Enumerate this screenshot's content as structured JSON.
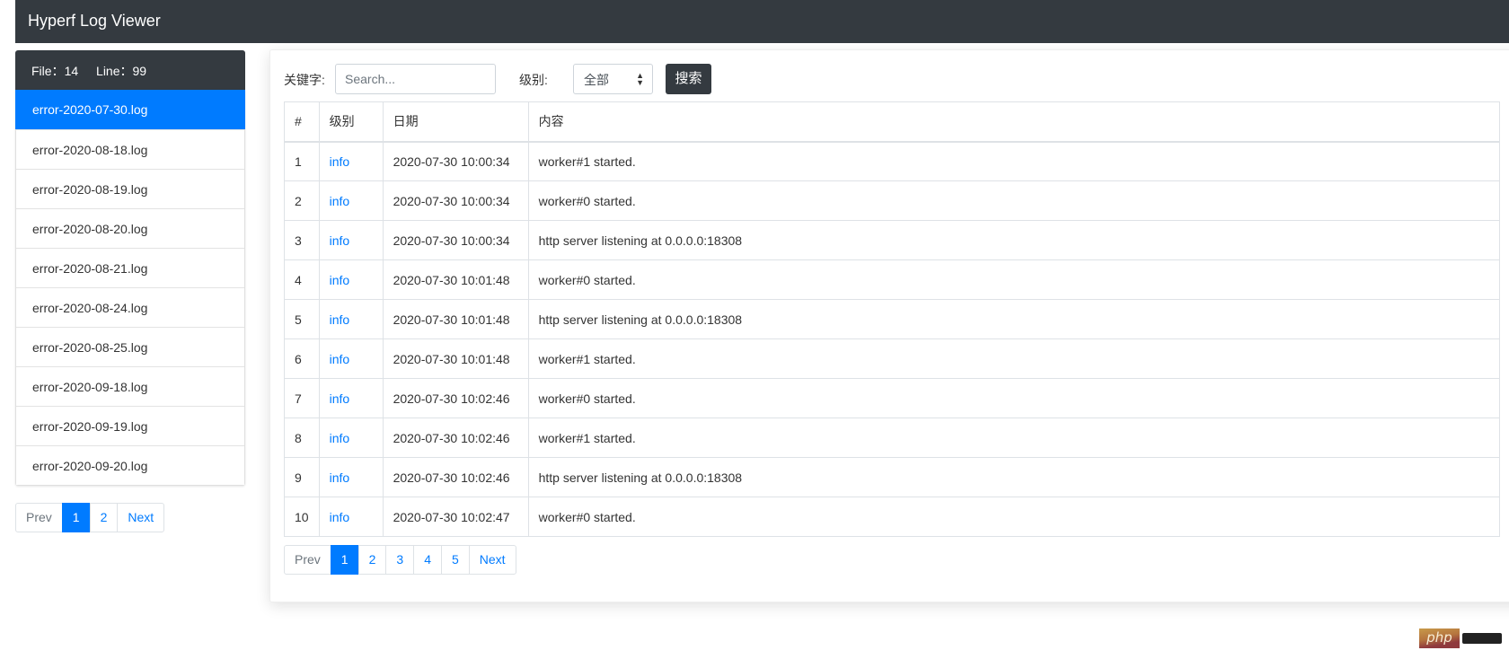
{
  "app": {
    "title": "Hyperf Log Viewer"
  },
  "sidebar": {
    "stats": {
      "file_label": "File：",
      "file_count": "14",
      "line_label": "Line：",
      "line_count": "99"
    },
    "files": [
      {
        "name": "error-2020-07-30.log",
        "active": true
      },
      {
        "name": "error-2020-08-18.log"
      },
      {
        "name": "error-2020-08-19.log"
      },
      {
        "name": "error-2020-08-20.log"
      },
      {
        "name": "error-2020-08-21.log"
      },
      {
        "name": "error-2020-08-24.log"
      },
      {
        "name": "error-2020-08-25.log"
      },
      {
        "name": "error-2020-09-18.log"
      },
      {
        "name": "error-2020-09-19.log"
      },
      {
        "name": "error-2020-09-20.log"
      }
    ],
    "pagination": {
      "prev": "Prev",
      "pages": [
        "1",
        "2"
      ],
      "current": "1",
      "next": "Next"
    }
  },
  "toolbar": {
    "keyword_label": "关键字:",
    "search_placeholder": "Search...",
    "search_value": "",
    "level_label": "级别:",
    "level_selected": "全部",
    "search_button": "搜索"
  },
  "table": {
    "headers": [
      "#",
      "级别",
      "日期",
      "内容"
    ],
    "rows": [
      {
        "n": "1",
        "level": "info",
        "date": "2020-07-30 10:00:34",
        "content": "worker#1 started."
      },
      {
        "n": "2",
        "level": "info",
        "date": "2020-07-30 10:00:34",
        "content": "worker#0 started."
      },
      {
        "n": "3",
        "level": "info",
        "date": "2020-07-30 10:00:34",
        "content": "http server listening at 0.0.0.0:18308"
      },
      {
        "n": "4",
        "level": "info",
        "date": "2020-07-30 10:01:48",
        "content": "worker#0 started."
      },
      {
        "n": "5",
        "level": "info",
        "date": "2020-07-30 10:01:48",
        "content": "http server listening at 0.0.0.0:18308"
      },
      {
        "n": "6",
        "level": "info",
        "date": "2020-07-30 10:01:48",
        "content": "worker#1 started."
      },
      {
        "n": "7",
        "level": "info",
        "date": "2020-07-30 10:02:46",
        "content": "worker#0 started."
      },
      {
        "n": "8",
        "level": "info",
        "date": "2020-07-30 10:02:46",
        "content": "worker#1 started."
      },
      {
        "n": "9",
        "level": "info",
        "date": "2020-07-30 10:02:46",
        "content": "http server listening at 0.0.0.0:18308"
      },
      {
        "n": "10",
        "level": "info",
        "date": "2020-07-30 10:02:47",
        "content": "worker#0 started."
      }
    ]
  },
  "main_pagination": {
    "prev": "Prev",
    "pages": [
      "1",
      "2",
      "3",
      "4",
      "5"
    ],
    "current": "1",
    "next": "Next"
  },
  "watermark": {
    "logo_text": "php"
  }
}
